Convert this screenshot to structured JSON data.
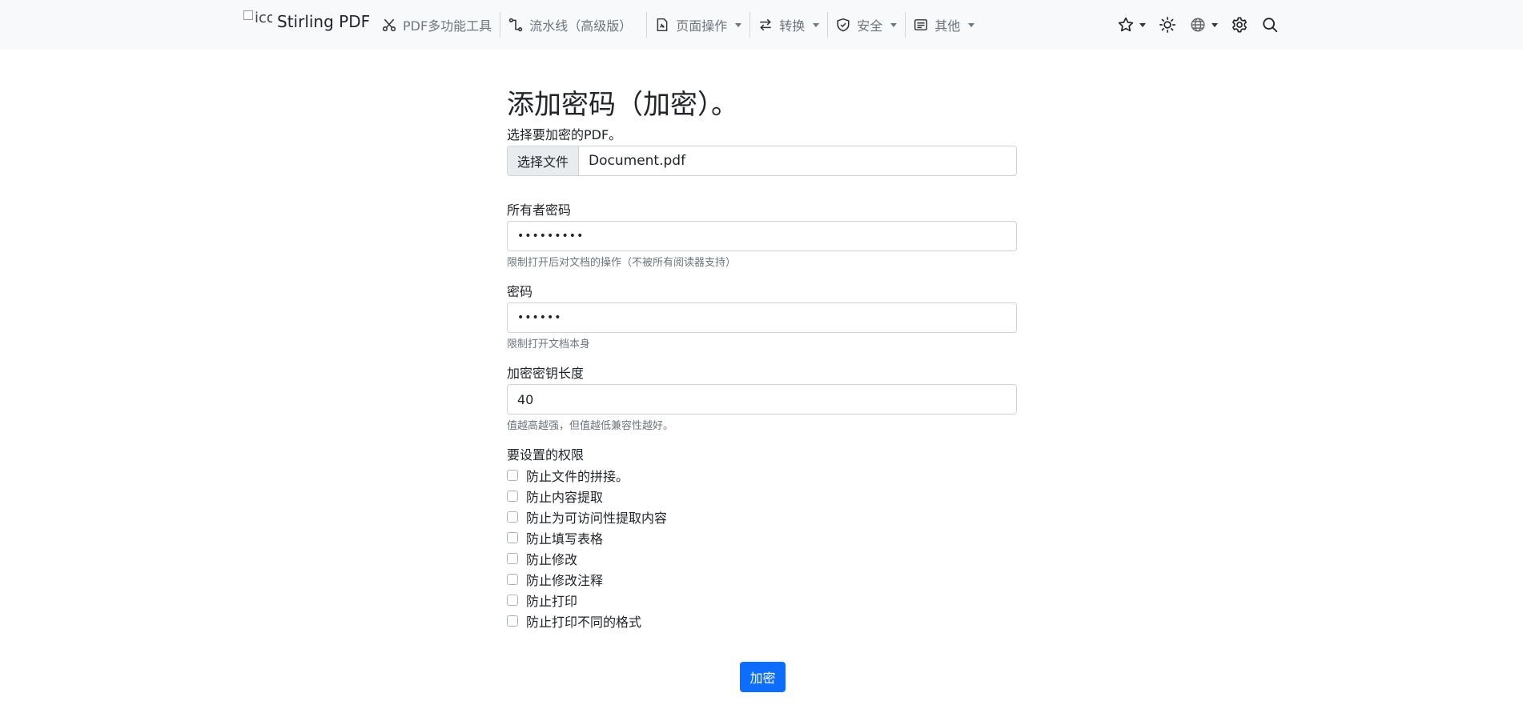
{
  "brand": {
    "img_alt": "icon",
    "name": "Stirling PDF"
  },
  "nav": {
    "items": [
      {
        "label": "PDF多功能工具",
        "icon": "scissors-icon",
        "dropdown": false
      },
      {
        "label": "流水线（高级版）",
        "icon": "pipeline-icon",
        "dropdown": false
      },
      {
        "label": "页面操作",
        "icon": "file-pdf-icon",
        "dropdown": true
      },
      {
        "label": "转换",
        "icon": "arrows-exchange-icon",
        "dropdown": true
      },
      {
        "label": "安全",
        "icon": "shield-icon",
        "dropdown": true
      },
      {
        "label": "其他",
        "icon": "card-text-icon",
        "dropdown": true
      }
    ],
    "right_icons": [
      "star-icon",
      "sun-icon",
      "globe-icon",
      "gear-icon",
      "search-icon"
    ]
  },
  "form": {
    "title": "添加密码（加密）。",
    "file_label": "选择要加密的PDF。",
    "file_button": "选择文件",
    "file_name": "Document.pdf",
    "owner_password_label": "所有者密码",
    "owner_password_value": "•••••••••",
    "owner_password_help": "限制打开后对文档的操作（不被所有阅读器支持）",
    "password_label": "密码",
    "password_value": "••••••",
    "password_help": "限制打开文档本身",
    "key_length_label": "加密密钥长度",
    "key_length_value": "40",
    "key_length_help": "值越高越强，但值越低兼容性越好。",
    "permissions_label": "要设置的权限",
    "permissions": [
      {
        "label": "防止文件的拼接。",
        "checked": false
      },
      {
        "label": "防止内容提取",
        "checked": false
      },
      {
        "label": "防止为可访问性提取内容",
        "checked": false
      },
      {
        "label": "防止填写表格",
        "checked": false
      },
      {
        "label": "防止修改",
        "checked": false
      },
      {
        "label": "防止修改注释",
        "checked": false
      },
      {
        "label": "防止打印",
        "checked": false
      },
      {
        "label": "防止打印不同的格式",
        "checked": false
      }
    ],
    "submit_label": "加密"
  },
  "colors": {
    "primary": "#0d6efd",
    "navbar_bg": "#f8f9fa",
    "muted": "#6c757d",
    "border": "#ced4da"
  }
}
